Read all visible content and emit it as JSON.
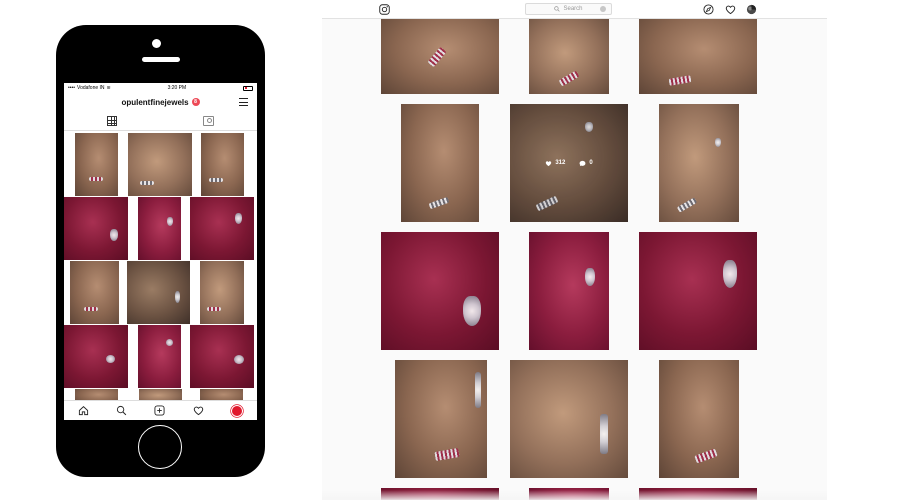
{
  "mobile": {
    "status": {
      "carrier": "Vodafone IN",
      "time": "3:20 PM"
    },
    "username": "opulentfinejewels",
    "notification_count": "8",
    "tabs": [
      "grid-tab",
      "tagged-tab"
    ],
    "nav_icons": [
      "home-icon",
      "search-icon",
      "new-post-icon",
      "activity-heart-icon",
      "profile-avatar"
    ]
  },
  "desktop": {
    "search_placeholder": "Search",
    "nav_icons": [
      "instagram-logo-icon",
      "explore-compass-icon",
      "activity-heart-icon",
      "profile-avatar"
    ],
    "hover_post": {
      "likes": "312",
      "comments": "0"
    }
  },
  "colors": {
    "accent_red": "#ed4956",
    "background": "#fafafa",
    "border": "#dbdbdb"
  }
}
